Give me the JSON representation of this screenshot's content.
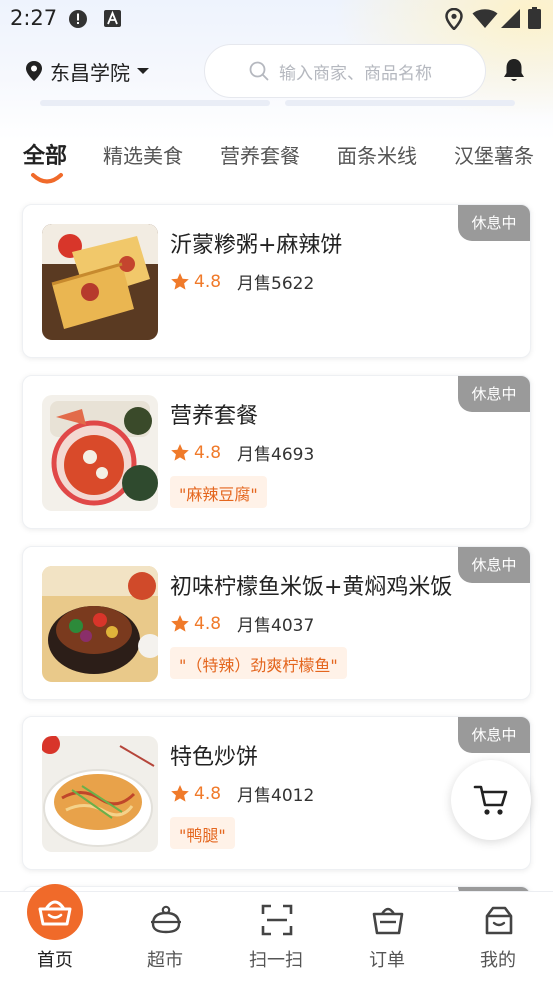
{
  "status_bar": {
    "time": "2:27"
  },
  "header": {
    "location": "东昌学院",
    "search_placeholder": "输入商家、商品名称"
  },
  "tabs": [
    {
      "label": "全部",
      "active": true
    },
    {
      "label": "精选美食",
      "active": false
    },
    {
      "label": "营养套餐",
      "active": false
    },
    {
      "label": "面条米线",
      "active": false
    },
    {
      "label": "汉堡薯条",
      "active": false
    }
  ],
  "shops": [
    {
      "name": "沂蒙糁粥+麻辣饼",
      "rating": "4.8",
      "sales": "月售5622",
      "tag": "",
      "status": "休息中"
    },
    {
      "name": "营养套餐",
      "rating": "4.8",
      "sales": "月售4693",
      "tag": "\"麻辣豆腐\"",
      "status": "休息中"
    },
    {
      "name": "初味柠檬鱼米饭+黄焖鸡米饭",
      "rating": "4.8",
      "sales": "月售4037",
      "tag": "\"（特辣）劲爽柠檬鱼\"",
      "status": "休息中"
    },
    {
      "name": "特色炒饼",
      "rating": "4.8",
      "sales": "月售4012",
      "tag": "\"鸭腿\"",
      "status": "休息中"
    }
  ],
  "bottom_nav": [
    {
      "label": "首页",
      "icon": "home-basket-icon",
      "active": true
    },
    {
      "label": "超市",
      "icon": "supermarket-icon",
      "active": false
    },
    {
      "label": "扫一扫",
      "icon": "scan-icon",
      "active": false
    },
    {
      "label": "订单",
      "icon": "order-icon",
      "active": false
    },
    {
      "label": "我的",
      "icon": "profile-icon",
      "active": false
    }
  ],
  "colors": {
    "accent": "#f06a2a",
    "closed_badge": "#9a9a9a",
    "tag_bg": "#fff2e8"
  }
}
